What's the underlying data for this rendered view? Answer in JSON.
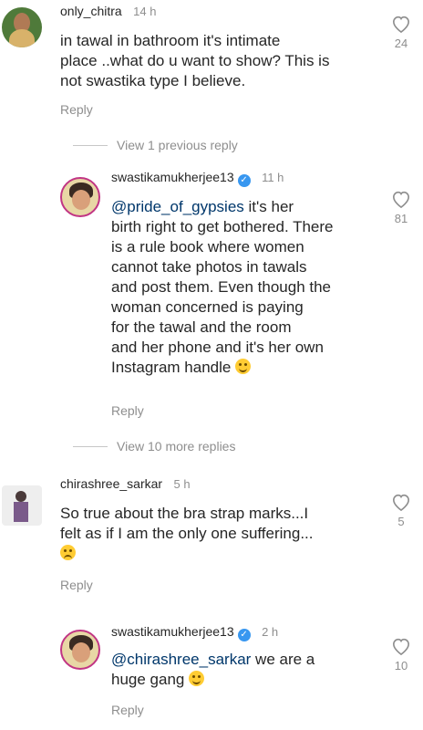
{
  "comments": [
    {
      "username": "only_chitra",
      "time": "14 h",
      "lines": [
        "in tawal in bathroom it's intimate",
        "place ..what do u want to show? This is",
        "not swastika type I believe."
      ],
      "likes": "24",
      "reply": "Reply"
    },
    {
      "view_previous": "View 1 previous reply"
    },
    {
      "username": "swastikamukherjee13",
      "time": "11 h",
      "mention": "@pride_of_gypsies",
      "first_line_rest": " it's her",
      "lines": [
        "birth right to get bothered. There",
        "is a rule book where women",
        "cannot take photos in tawals",
        "and post them. Even though the",
        "woman concerned is paying",
        "for the tawal and the room",
        "and her phone and it's her own",
        "Instagram handle"
      ],
      "likes": "81",
      "reply": "Reply"
    },
    {
      "view_more": "View 10 more replies"
    },
    {
      "username": "chirashree_sarkar",
      "time": "5 h",
      "lines": [
        "So true about the bra strap marks...I",
        "felt as if I am the only one suffering..."
      ],
      "likes": "5",
      "reply": "Reply"
    },
    {
      "username": "swastikamukherjee13",
      "time": "2 h",
      "mention": "@chirashree_sarkar",
      "first_line_rest": " we are a",
      "lines": [
        "huge gang"
      ],
      "likes": "10",
      "reply": "Reply"
    }
  ],
  "colors": {
    "text": "#262626",
    "muted": "#8e8e8e",
    "mention": "#00376b",
    "verified": "#3897f0"
  }
}
